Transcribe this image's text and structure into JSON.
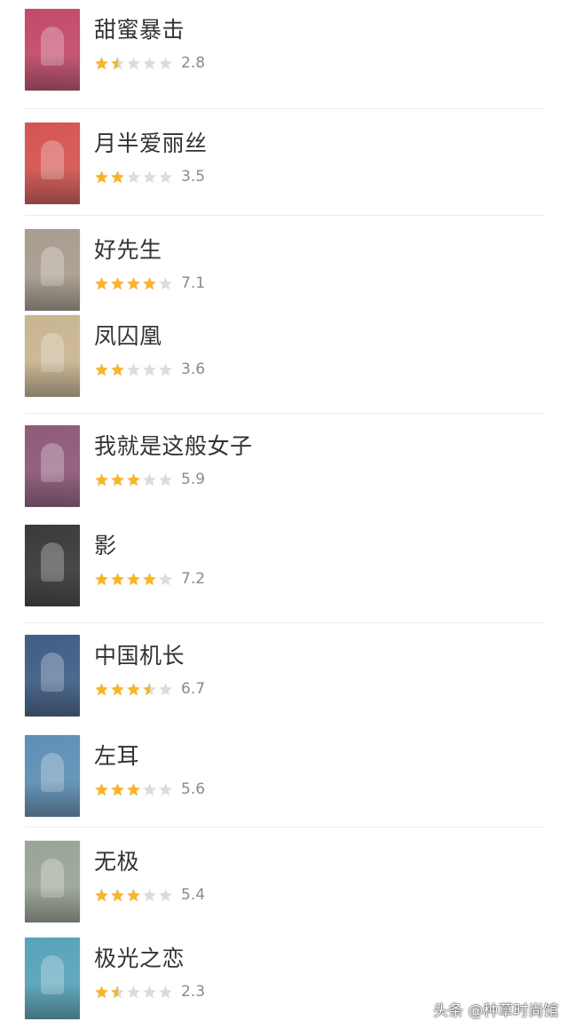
{
  "colors": {
    "star_filled": "#f7b52b",
    "star_empty": "#dcdcdc",
    "title": "#333333",
    "score": "#8a8a8a"
  },
  "star_icon": "star-icon",
  "items": [
    {
      "title": "甜蜜暴击",
      "rating": "2.8",
      "stars": 1.5,
      "poster_color": "#c24a6a"
    },
    {
      "title": "月半爱丽丝",
      "rating": "3.5",
      "stars": 2,
      "poster_color": "#d45550"
    },
    {
      "title": "好先生",
      "rating": "7.1",
      "stars": 4,
      "poster_color": "#a79c8e"
    },
    {
      "title": "凤囚凰",
      "rating": "3.6",
      "stars": 2,
      "poster_color": "#c9b590"
    },
    {
      "title": "我就是这般女子",
      "rating": "5.9",
      "stars": 3,
      "poster_color": "#8e5a7a"
    },
    {
      "title": "影",
      "rating": "7.2",
      "stars": 4,
      "poster_color": "#3a3a3a"
    },
    {
      "title": "中国机长",
      "rating": "6.7",
      "stars": 3.5,
      "poster_color": "#3f5e86"
    },
    {
      "title": "左耳",
      "rating": "5.6",
      "stars": 3,
      "poster_color": "#5e8fb5"
    },
    {
      "title": "无极",
      "rating": "5.4",
      "stars": 3,
      "poster_color": "#9aa496"
    },
    {
      "title": "极光之恋",
      "rating": "2.3",
      "stars": 1.5,
      "poster_color": "#57a3ba"
    }
  ],
  "watermark": "头条 @种草时尚馆"
}
